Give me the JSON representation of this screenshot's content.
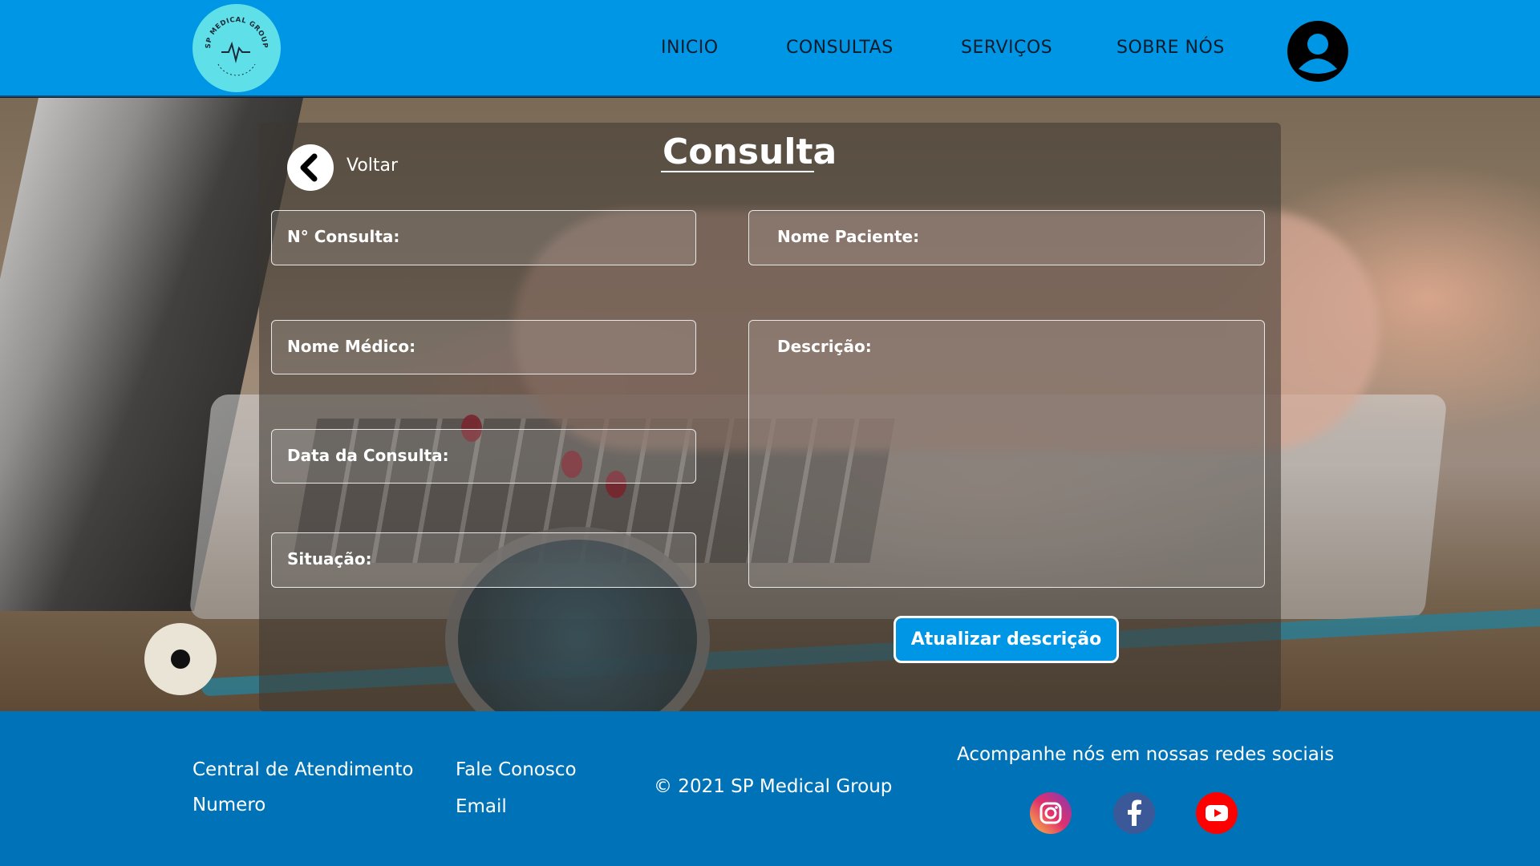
{
  "header": {
    "logo_text": "SP MEDICAL GROUP",
    "nav": [
      "INICIO",
      "CONSULTAS",
      "SERVIÇOS",
      "SOBRE NÓS"
    ]
  },
  "form": {
    "back_label": "Voltar",
    "title": "Consulta",
    "fields": {
      "consulta_num": "N° Consulta:",
      "paciente": "Nome Paciente:",
      "medico": "Nome Médico:",
      "descricao": "Descrição:",
      "data": "Data da Consulta:",
      "situacao": "Situação:"
    },
    "submit_label": "Atualizar descrição"
  },
  "footer": {
    "central": "Central de Atendimento",
    "numero": "Numero",
    "fale": "Fale Conosco",
    "email": "Email",
    "copyright": "© 2021 SP Medical Group",
    "social_heading": "Acompanhe nós em nossas redes sociais",
    "social_icons": [
      "instagram-icon",
      "facebook-icon",
      "youtube-icon"
    ]
  },
  "colors": {
    "header_bg": "#0096e6",
    "footer_bg": "#0073b8",
    "accent": "#0096e6",
    "logo_bg": "#5fe0e8"
  }
}
